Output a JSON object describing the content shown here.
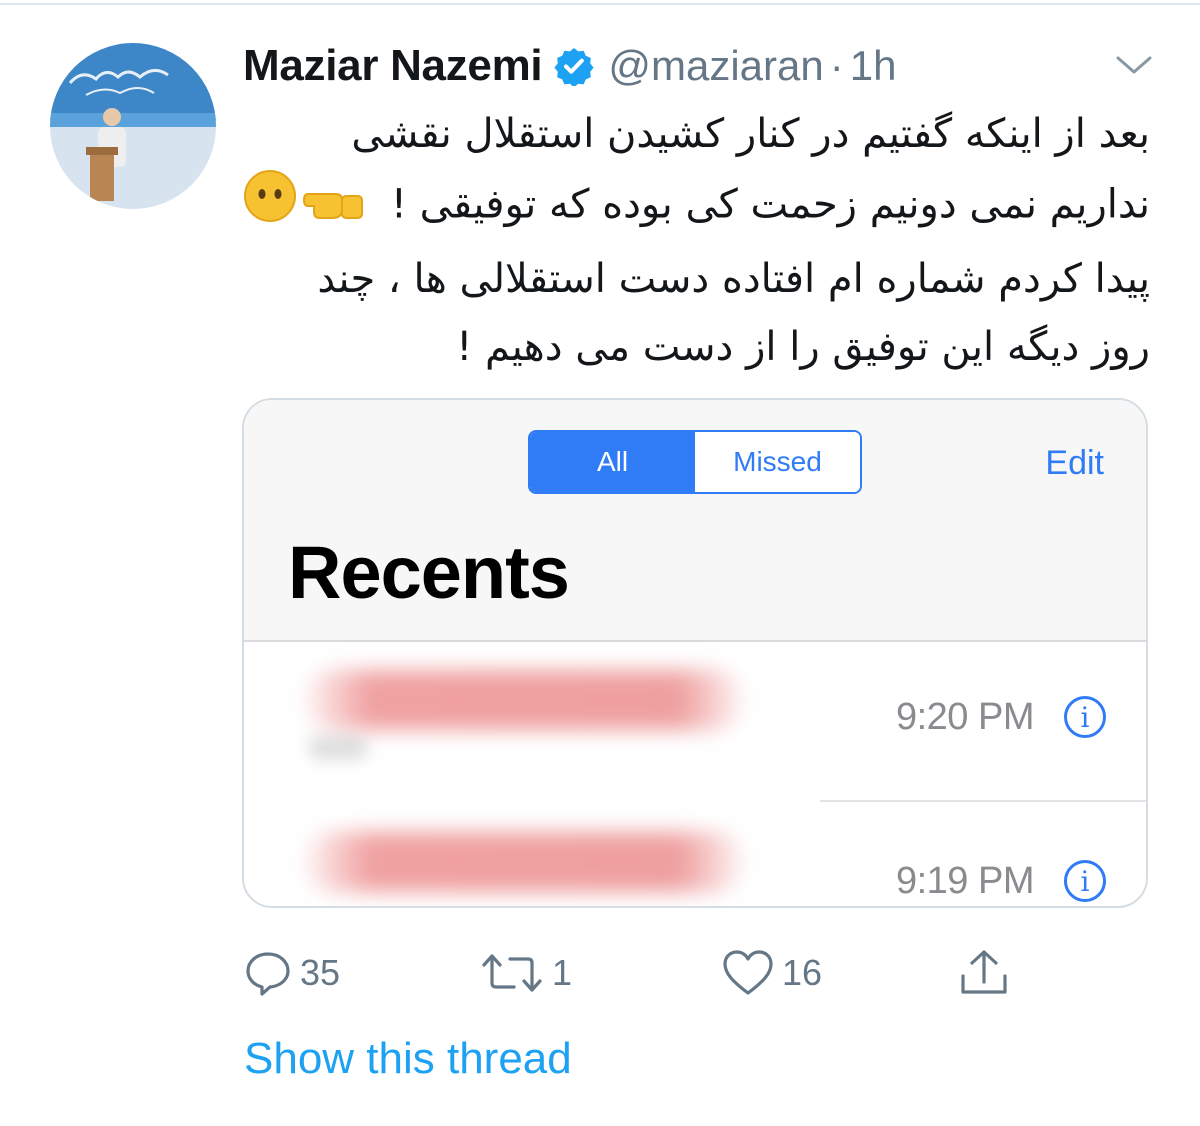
{
  "tweet": {
    "author": {
      "display_name": "Maziar Nazemi",
      "handle": "@maziaran",
      "verified": true,
      "avatar_icon": "profile-photo-speaker-at-podium"
    },
    "separator": "·",
    "time": "1h",
    "text_lines": [
      "بعد از اینکه گفتیم در کنار کشیدن استقلال نقشی",
      "نداریم نمی دونیم زحمت کی بوده که توفیقی  ! ",
      "پیدا کردم شماره ام افتاده دست استقلالی ها ، چند",
      "روز دیگه این توفیق را از دست می دهیم !"
    ],
    "emojis": [
      "backhand-index-pointing-left",
      "face-without-mouth"
    ],
    "more_icon": "chevron-down-icon"
  },
  "media": {
    "segmented_control": {
      "options": [
        "All",
        "Missed"
      ],
      "selected": "All"
    },
    "edit_label": "Edit",
    "title": "Recents",
    "calls": [
      {
        "name_blurred": true,
        "time": "9:20 PM"
      },
      {
        "name_blurred": true,
        "time": "9:19 PM"
      }
    ],
    "info_glyph": "i",
    "accent_color": "#2f7cf6"
  },
  "actions": {
    "reply_count": "35",
    "retweet_count": "1",
    "like_count": "16",
    "icons": [
      "reply-icon",
      "retweet-icon",
      "like-icon",
      "share-icon"
    ]
  },
  "show_thread_label": "Show this thread",
  "colors": {
    "link_blue": "#1da1f2",
    "muted_gray": "#657786",
    "verified_blue": "#1da1f2"
  }
}
